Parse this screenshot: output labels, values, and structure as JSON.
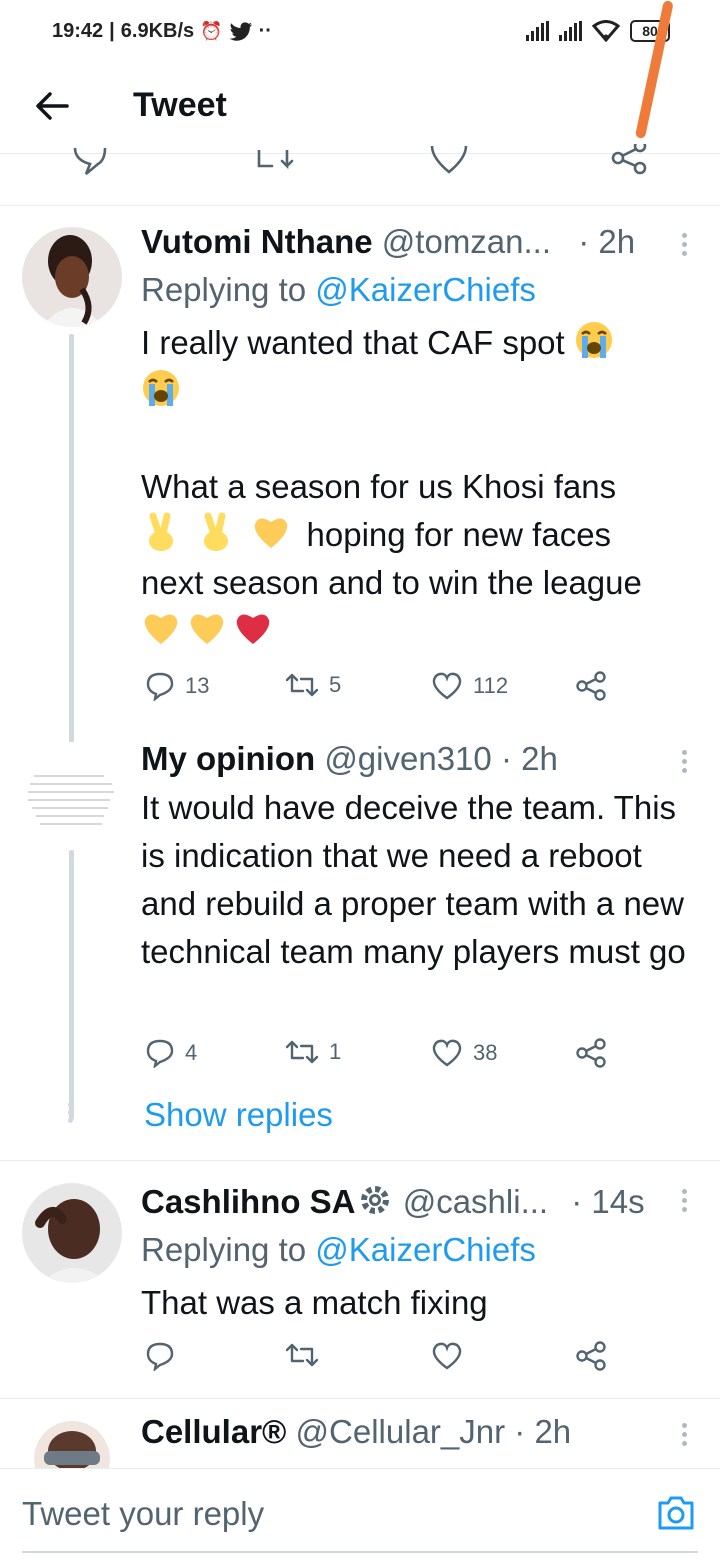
{
  "status_bar": {
    "time": "19:42",
    "speed": "6.9KB/s",
    "battery": "80"
  },
  "header": {
    "title": "Tweet"
  },
  "tweets": [
    {
      "name": "Vutomi Nthane",
      "handle": "@tomzan...",
      "time": "· 2h",
      "replying_prefix": "Replying to",
      "replying_to": "@KaizerChiefs",
      "text_line1": "I really wanted that CAF spot",
      "text_line2": "What a season for us Khosi fans",
      "text_line3": "hoping for new faces",
      "text_line4": "next season and to win the league",
      "replies": "13",
      "retweets": "5",
      "likes": "112"
    },
    {
      "name": "My opinion",
      "handle": "@given310",
      "time": "· 2h",
      "text": "It would have deceive the team. This is indication that we need a reboot and rebuild a proper team with a new technical team many players must go",
      "replies": "4",
      "retweets": "1",
      "likes": "38",
      "show_replies": "Show replies"
    },
    {
      "name": "Cashlihno SA",
      "handle": "@cashli...",
      "time": "· 14s",
      "replying_prefix": "Replying to",
      "replying_to": "@KaizerChiefs",
      "text": "That was a match fixing"
    },
    {
      "name": "Cellular®",
      "handle": "@Cellular_Jnr",
      "time": "· 2h"
    }
  ],
  "reply_bar": {
    "placeholder": "Tweet your reply"
  },
  "colors": {
    "accent": "#1d9bf0",
    "secondary_text": "#536471",
    "divider": "#e6ecf0"
  }
}
